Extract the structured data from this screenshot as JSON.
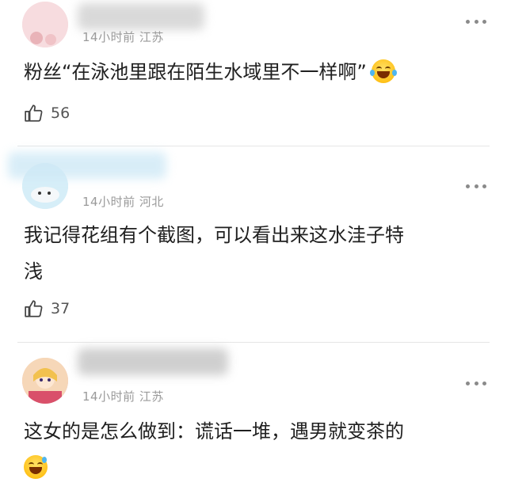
{
  "comments": [
    {
      "meta": "14小时前 江苏",
      "text": "粉丝“在泳池里跟在陌生水域里不一样啊”",
      "emoji": "laughing-tears-emoji",
      "likes": "56"
    },
    {
      "meta": "14小时前 河北",
      "text_line1": "我记得花组有个截图，可以看出来这水洼子特",
      "text_line2": "浅",
      "likes": "37"
    },
    {
      "meta": "14小时前 江苏",
      "text": "这女的是怎么做到：谎话一堆，遇男就变茶的",
      "emoji": "sweat-smile-emoji"
    }
  ],
  "colors": {
    "meta": "#9a9a9a",
    "text": "#202020",
    "divider": "#e6e6e6"
  },
  "icons": [
    "more-icon",
    "thumbs-up-icon",
    "laughing-tears-emoji",
    "sweat-smile-emoji"
  ]
}
